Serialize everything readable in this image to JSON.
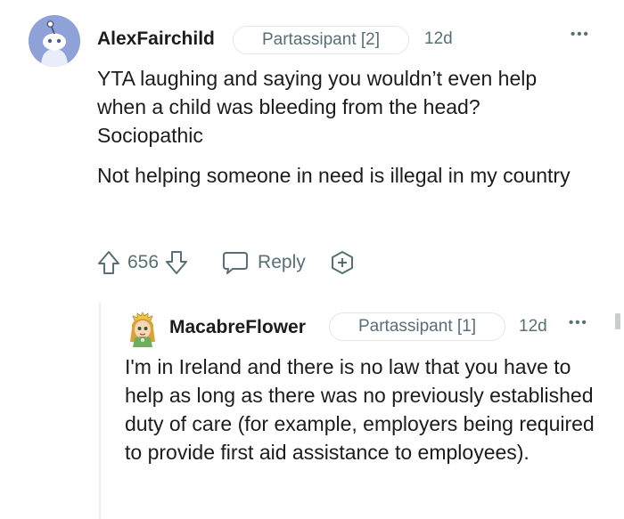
{
  "comment": {
    "author": "AlexFairchild",
    "flair": "Partassipant [2]",
    "time": "12d",
    "more_label": "•••",
    "paragraphs": [
      "YTA laughing and saying you wouldn’t even help when a child was bleeding from the head? Sociopathic",
      "Not helping someone in need is illegal in my country"
    ],
    "score": "656",
    "reply_label": "Reply"
  },
  "reply": {
    "author": "MacabreFlower",
    "flair": "Partassipant [1]",
    "time": "12d",
    "more_label": "•••",
    "text": "I'm in Ireland and there is no law that you have to help as long as there was no previously established duty of care (for example, employers being required to provide first aid assistance to employees)."
  }
}
